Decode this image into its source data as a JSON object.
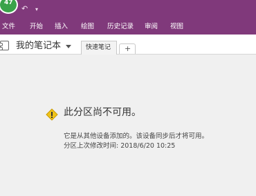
{
  "quick_access": {
    "notification_count": "47"
  },
  "ribbon": {
    "tabs": [
      "文件",
      "开始",
      "插入",
      "绘图",
      "历史记录",
      "审阅",
      "视图"
    ]
  },
  "notebook": {
    "name": "我的笔记本",
    "section_tab": "快速笔记",
    "add_tab": "+"
  },
  "message": {
    "title": "此分区尚不可用。",
    "line1": "它是从其他设备添加的。该设备同步后才将可用。",
    "line2": "分区上次修改时间: 2018/6/20 10:25"
  },
  "colors": {
    "ribbon": "#80397b",
    "badge": "#3aa34a",
    "warning": "#f0c419"
  },
  "icons": {
    "undo": "undo-icon",
    "customize": "customize-qat-icon",
    "notebook": "notebook-icon",
    "warning": "warning-icon"
  }
}
